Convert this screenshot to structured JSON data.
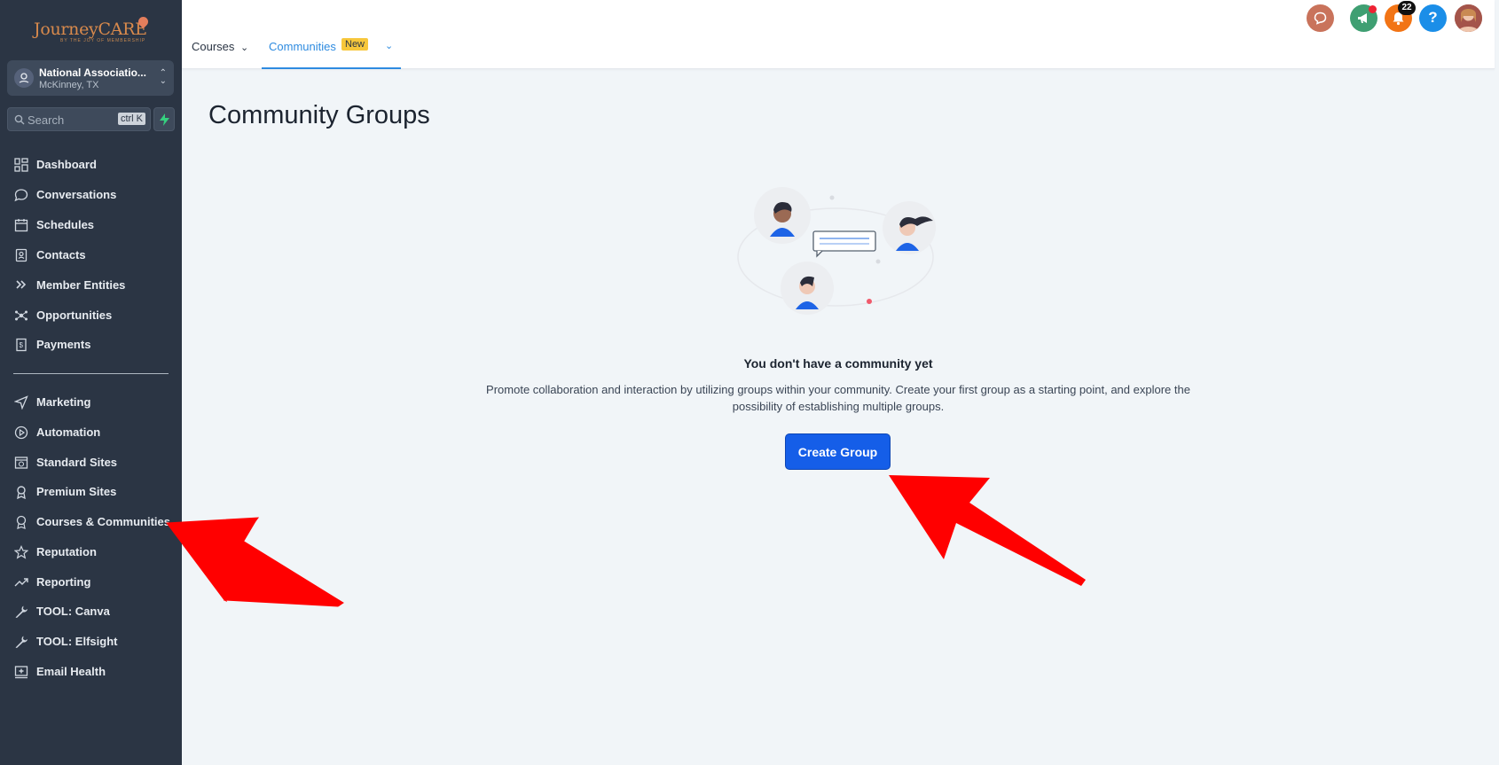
{
  "brand": {
    "logo_word": "JourneyCARE",
    "logo_tagline": "BY THE JOY OF MEMBERSHIP"
  },
  "account": {
    "name": "National Associatio...",
    "location": "McKinney, TX"
  },
  "search": {
    "placeholder": "Search",
    "shortcut": "ctrl K"
  },
  "sidebar": {
    "items": [
      {
        "label": "Dashboard",
        "icon": "grid-icon"
      },
      {
        "label": "Conversations",
        "icon": "chat-icon"
      },
      {
        "label": "Schedules",
        "icon": "calendar-icon"
      },
      {
        "label": "Contacts",
        "icon": "contact-book-icon"
      },
      {
        "label": "Member Entities",
        "icon": "double-chevron-icon"
      },
      {
        "label": "Opportunities",
        "icon": "network-icon"
      },
      {
        "label": "Payments",
        "icon": "receipt-icon"
      }
    ],
    "items2": [
      {
        "label": "Marketing",
        "icon": "send-icon"
      },
      {
        "label": "Automation",
        "icon": "play-circle-icon"
      },
      {
        "label": "Standard Sites",
        "icon": "web-icon"
      },
      {
        "label": "Premium Sites",
        "icon": "badge-icon"
      },
      {
        "label": "Courses & Communities",
        "icon": "award-icon"
      },
      {
        "label": "Reputation",
        "icon": "star-icon"
      },
      {
        "label": "Reporting",
        "icon": "trend-icon"
      },
      {
        "label": "TOOL: Canva",
        "icon": "wrench-icon"
      },
      {
        "label": "TOOL: Elfsight",
        "icon": "wrench-icon"
      },
      {
        "label": "Email Health",
        "icon": "email-health-icon"
      }
    ]
  },
  "tabs": {
    "courses": "Courses",
    "communities": "Communities",
    "new_badge": "New"
  },
  "header": {
    "notification_count": "22",
    "help": "?"
  },
  "main": {
    "title": "Community Groups",
    "empty_title": "You don't have a community yet",
    "empty_desc_line1": "Promote collaboration and interaction by utilizing groups within your community. Create your first group as a starting point, and explore the",
    "empty_desc_line2": "possibility of establishing multiple groups.",
    "create_button": "Create Group"
  },
  "colors": {
    "sidebar_bg": "#2b3544",
    "accent_blue": "#155ee8",
    "tab_active": "#2e8be0",
    "annotation_arrow": "#ff0000"
  }
}
